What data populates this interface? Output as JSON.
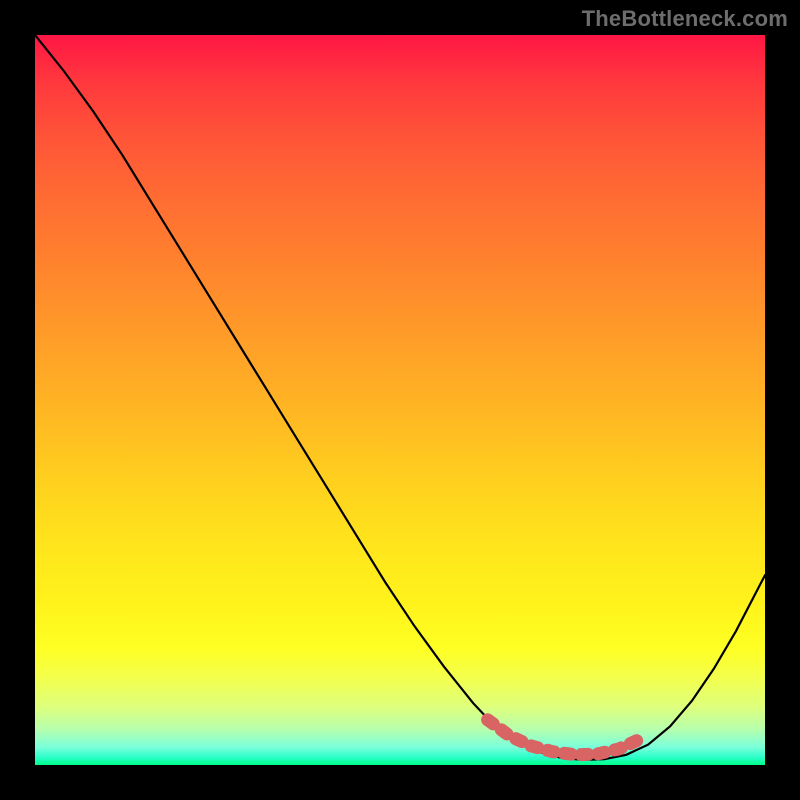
{
  "attribution": "TheBottleneck.com",
  "colors": {
    "frame": "#000000",
    "curve": "#000000",
    "marker": "#d86464",
    "gradient_top": "#ff1744",
    "gradient_bottom": "#00ff88"
  },
  "chart_data": {
    "type": "line",
    "title": "",
    "xlabel": "",
    "ylabel": "",
    "xlim": [
      0,
      100
    ],
    "ylim": [
      0,
      100
    ],
    "annotations": [
      "TheBottleneck.com"
    ],
    "series": [
      {
        "name": "bottleneck-curve",
        "x": [
          0,
          4,
          8,
          12,
          16,
          20,
          24,
          28,
          32,
          36,
          40,
          44,
          48,
          52,
          56,
          60,
          63,
          66,
          69,
          72,
          75,
          78,
          81,
          84,
          87,
          90,
          93,
          96,
          100
        ],
        "y": [
          100,
          95,
          89.5,
          83.5,
          77,
          70.5,
          64,
          57.5,
          51,
          44.5,
          38,
          31.5,
          25,
          19,
          13.5,
          8.5,
          5.3,
          3.2,
          1.8,
          1,
          0.7,
          0.8,
          1.4,
          2.8,
          5.3,
          8.8,
          13.2,
          18.3,
          26
        ]
      },
      {
        "name": "optimal-range-marker",
        "x": [
          62,
          65,
          68,
          71,
          74,
          77,
          80,
          83
        ],
        "y": [
          6.2,
          4.0,
          2.6,
          1.8,
          1.4,
          1.5,
          2.2,
          3.6
        ]
      }
    ]
  }
}
